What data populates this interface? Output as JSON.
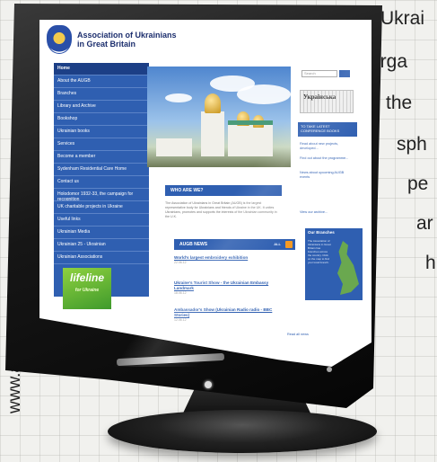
{
  "caption": {
    "lines": [
      "Ukrai",
      "orga",
      "the",
      "sph",
      "pe",
      "ar",
      "h"
    ]
  },
  "side_url": "www.augb.co.uk",
  "site": {
    "title_line1": "Association of Ukrainians",
    "title_line2": "in Great Britain",
    "nav": [
      "Home",
      "About the AUGB",
      "Branches",
      "Library and Archive",
      "Bookshop",
      "Ukrainian books",
      "Services",
      "Become a member",
      "Sydenham Residential Care Home",
      "Contact us",
      "Holodomor 1932-33, the campaign for recognition",
      "UK charitable projects in Ukraine",
      "Useful links",
      "Ukrainian Media",
      "Ukrainian 25 - Ukrainian",
      "Ukrainian Associations"
    ],
    "lifeline_banner": "lifeline",
    "lifeline_sub": "for Ukraine",
    "who_heading": "WHO ARE WE?",
    "who_text": "The Association of Ukrainians in Great Britain (AUGB) is the largest representative body for Ukrainians and friends of Ukraine in the UK. It unites Ukrainians, promotes and supports the interests of the Ukrainian community in the U.K.",
    "news_heading": "AUGB NEWS",
    "news_more": "ALL",
    "news": [
      {
        "title": "World's largest embroidery exhibition",
        "date": "22.06.12"
      },
      {
        "title": "Ukraine's Tourist Show - the Ukrainian Embassy Landmark",
        "date": "18.06.12"
      },
      {
        "title": "Ambassador's Show (Ukrainian Radio radio - BBC Stories)",
        "date": "12.06.12"
      }
    ],
    "search_placeholder": "Search",
    "newspaper_label": "Українська",
    "latest_heading": "TO TAKE LATEST CONFERENCE BOOKS",
    "right_links": [
      "Read about new projects, developed...",
      "Find out about the programme...",
      "News about upcoming AUGB events",
      "View our archive..."
    ],
    "branches_title": "Our Branches",
    "branches_text": "The Association of Ukrainians in Great Britain has branches across the country. Click on the map to find your local branch.",
    "read_all": "Read all news"
  }
}
